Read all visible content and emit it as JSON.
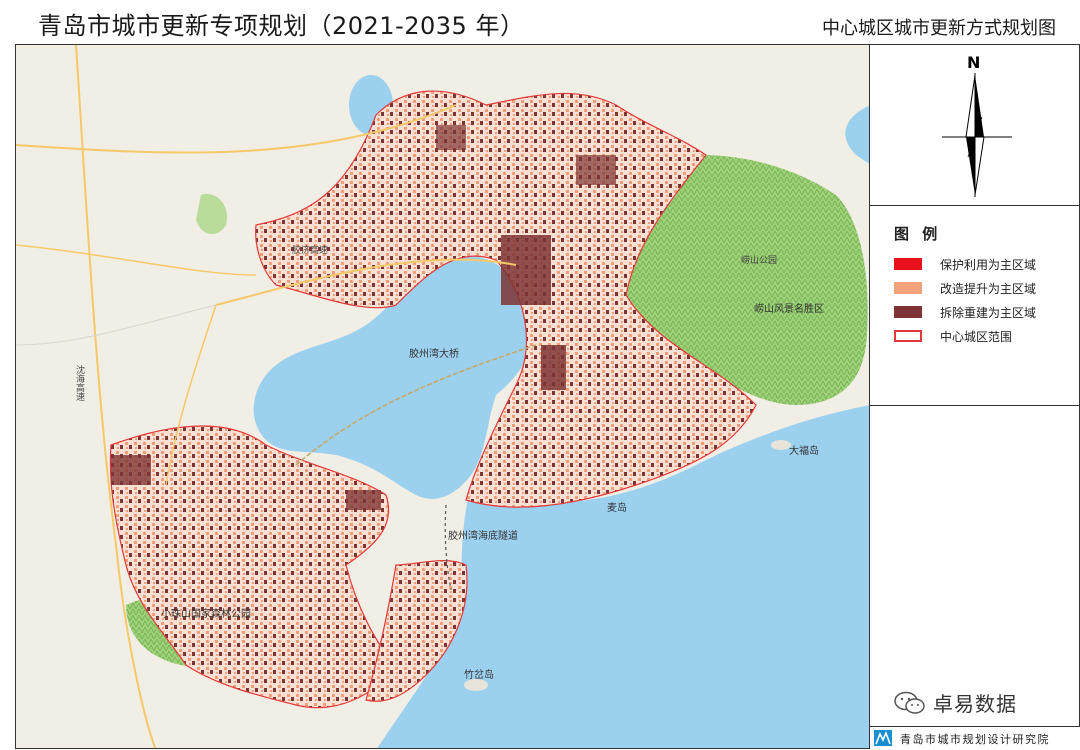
{
  "header": {
    "doc_title": "青岛市城市更新专项规划（2021-2035 年）",
    "map_title": "中心城区城市更新方式规划图"
  },
  "compass": {
    "north_label": "N"
  },
  "legend": {
    "title": "图 例",
    "items": [
      {
        "label": "保护利用为主区域",
        "color": "#e8101a",
        "style": "fill"
      },
      {
        "label": "改造提升为主区域",
        "color": "#f2a27a",
        "style": "fill"
      },
      {
        "label": "拆除重建为主区域",
        "color": "#7e3434",
        "style": "fill"
      },
      {
        "label": "中心城区范围",
        "color": "#e23a3a",
        "style": "outline"
      }
    ]
  },
  "map_labels": {
    "bay_bridge": "胶州湾大桥",
    "bay_tunnel": "胶州湾海底隧道",
    "laoshan": "崂山风景名胜区",
    "dafu_island": "大福岛",
    "fu_island": "麦岛",
    "zhuchadao": "竹岔岛",
    "xiaozhu_park": "小珠山国家森林公园",
    "expressway": "沈海高速",
    "jiaozhou_road": "胶济高速",
    "shangmao": "崂山公园"
  },
  "watermark": {
    "text": "卓易数据"
  },
  "footer": {
    "institute": "青岛市城市规划设计研究院"
  }
}
